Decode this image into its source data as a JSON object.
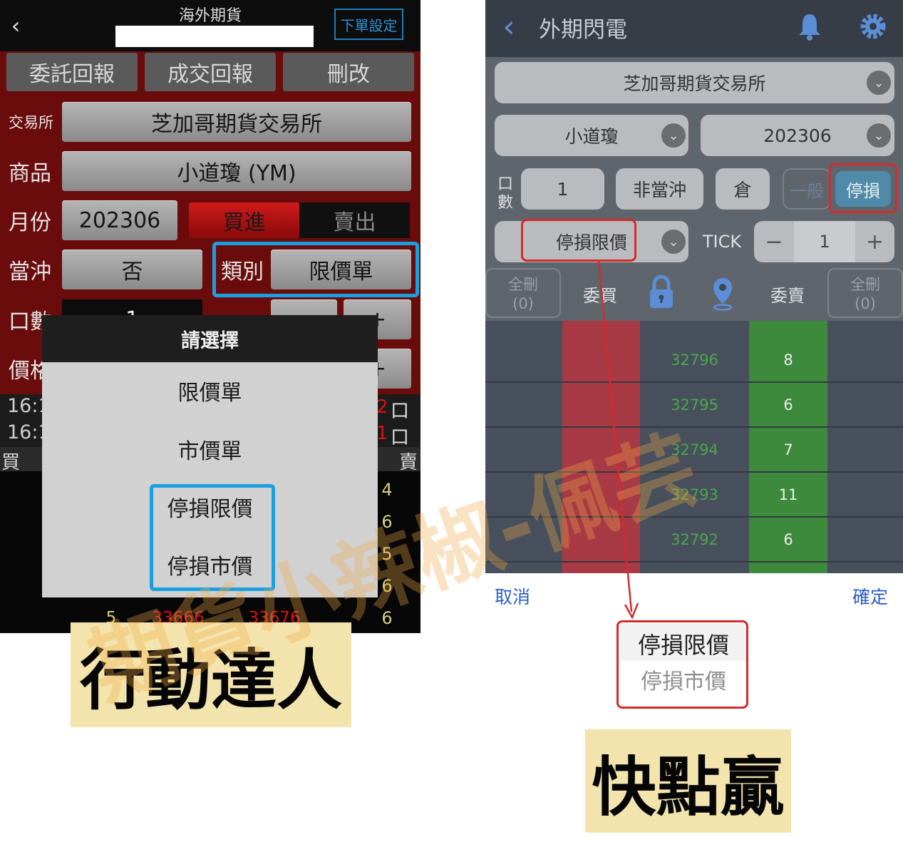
{
  "left_app": {
    "title": "海外期貨",
    "order_settings": "下單設定",
    "tabs": [
      "委託回報",
      "成交回報",
      "刪改"
    ],
    "exchange_label": "交易所",
    "exchange_value": "芝加哥期貨交易所",
    "product_label": "商品",
    "product_value": "小道瓊 (YM)",
    "month_label": "月份",
    "month_value": "202306",
    "buy_label": "買進",
    "sell_label": "賣出",
    "daytrade_label": "當沖",
    "daytrade_value": "否",
    "type_label": "類別",
    "type_value": "限價單",
    "qty_label": "口數",
    "qty_value": "1",
    "price_label": "價格",
    "minus": "−",
    "plus": "+",
    "time1": "16:1",
    "time2": "16:1",
    "lots1_num": "2",
    "lots1_unit": "口",
    "lots2_num": "1",
    "lots2_unit": "口",
    "buy_col": "買",
    "sell_col": "賣",
    "book_right": [
      "4",
      "6",
      "5",
      "6",
      "6"
    ],
    "book_bottom": {
      "left": "5",
      "bid": "33666",
      "ask": "33676"
    },
    "popup": {
      "title": "請選擇",
      "items": [
        "限價單",
        "市價單",
        "停損限價",
        "停損市價"
      ]
    },
    "caption": "行動達人"
  },
  "right_app": {
    "title": "外期閃電",
    "exchange": "芝加哥期貨交易所",
    "product": "小道瓊",
    "month": "202306",
    "qty_label": "口數",
    "qty_label_chars": [
      "口",
      "數"
    ],
    "qty_value": "1",
    "daytrade": "非當沖",
    "position": "倉",
    "mode_normal": "一般",
    "mode_stop": "停損",
    "order_type": "停損限價",
    "tick_label": "TICK",
    "tick_value": "1",
    "minus": "−",
    "plus": "+",
    "del_all_label": "全刪",
    "del_all_left": "(0)",
    "del_all_right": "(0)",
    "bid_header": "委買",
    "ask_header": "委賣",
    "ladder": [
      {
        "price": "32796",
        "qty": "8"
      },
      {
        "price": "32795",
        "qty": "6"
      },
      {
        "price": "32794",
        "qty": "7"
      },
      {
        "price": "32793",
        "qty": "11"
      },
      {
        "price": "32792",
        "qty": "6"
      }
    ],
    "cancel": "取消",
    "confirm": "確定",
    "picker_selected": "停損限價",
    "picker_next": "停損市價",
    "caption": "快點贏"
  },
  "watermark": "期貨小辣椒-佩芸",
  "colors": {
    "highlight_blue": "#19a0e0",
    "highlight_red": "#d42b2b",
    "left_bg": "#6b0c0c",
    "right_bg": "#3f4650",
    "caption_bg": "#f3e4ae"
  }
}
